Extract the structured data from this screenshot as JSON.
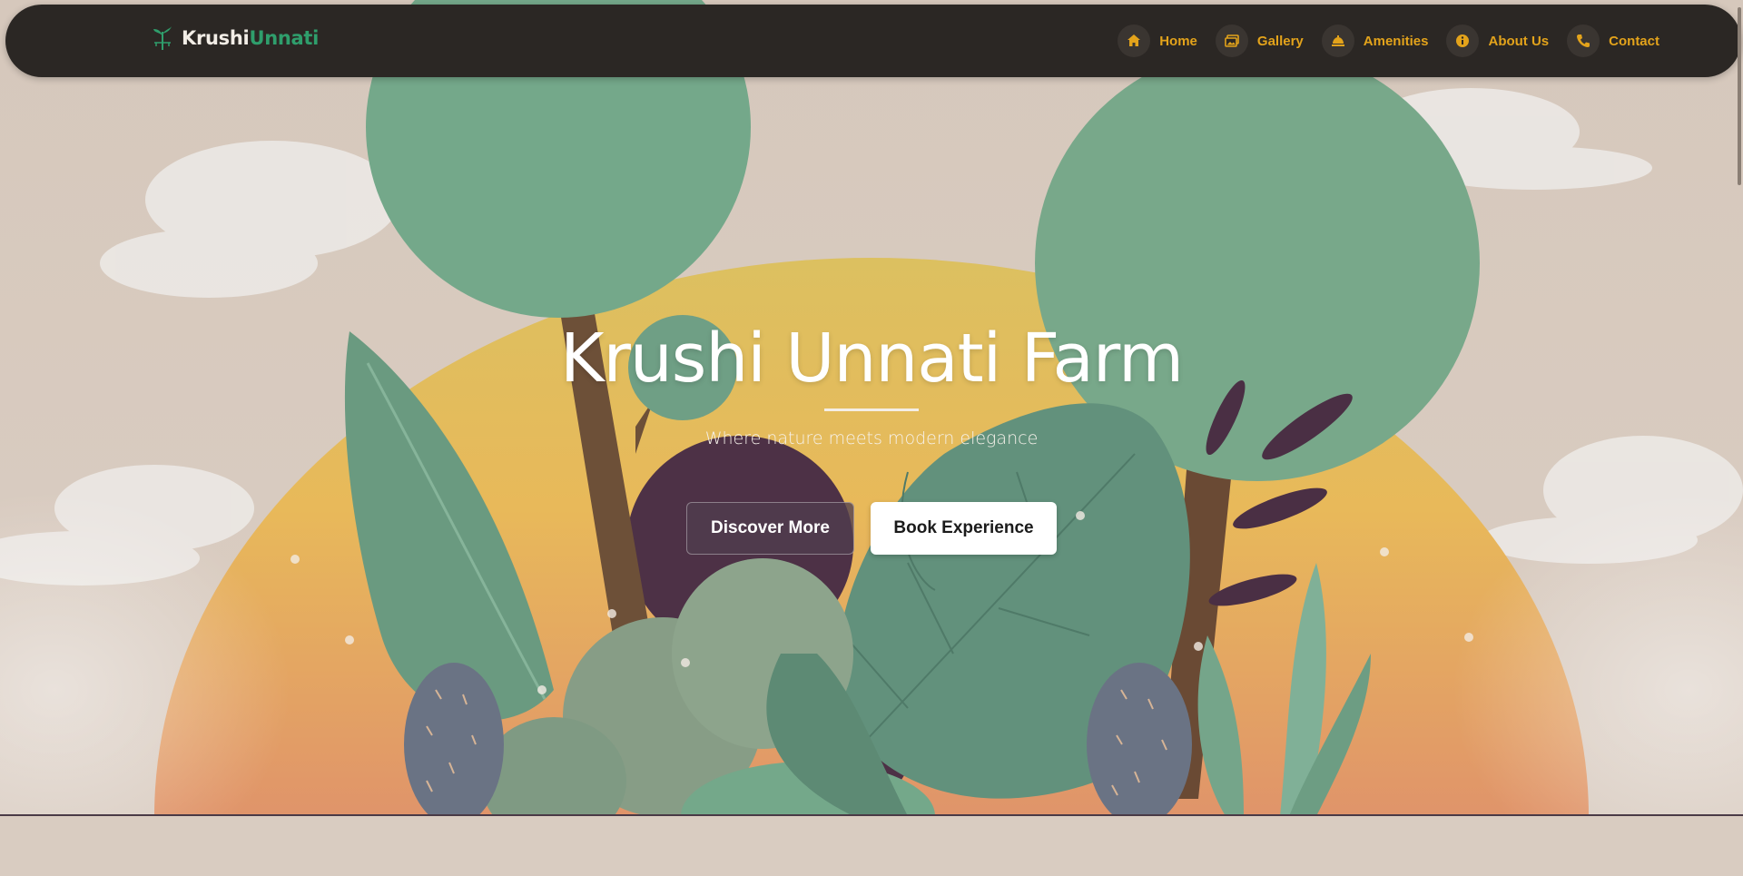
{
  "brand": {
    "name_part1": "Krushi",
    "name_part2": "Unnati",
    "logo_icon": "plant-icon"
  },
  "nav": {
    "items": [
      {
        "label": "Home",
        "icon": "home-icon"
      },
      {
        "label": "Gallery",
        "icon": "gallery-icon"
      },
      {
        "label": "Amenities",
        "icon": "service-bell-icon"
      },
      {
        "label": "About Us",
        "icon": "info-icon"
      },
      {
        "label": "Contact",
        "icon": "phone-icon"
      }
    ]
  },
  "hero": {
    "title": "Krushi Unnati Farm",
    "subtitle": "Where nature meets modern elegance",
    "primary_button": "Discover More",
    "secondary_button": "Book Experience"
  },
  "colors": {
    "navbar_bg": "#2b2724",
    "nav_accent": "#e3a31b",
    "brand_green": "#2f9e6c",
    "sun": "#e5b55a",
    "tree_green": "#74a88a",
    "trunk": "#6d5038",
    "plum": "#4a2f44"
  }
}
